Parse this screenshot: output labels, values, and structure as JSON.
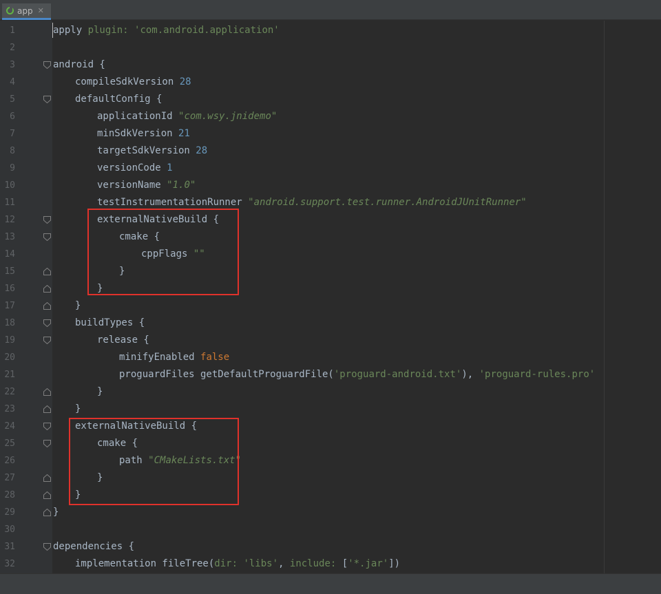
{
  "tab": {
    "label": "app",
    "close": "✕"
  },
  "code_lines": [
    {
      "n": "1",
      "indent": 0,
      "fold": null,
      "tokens": [
        [
          "apply ",
          "plain"
        ],
        [
          "plugin: ",
          "kw-arg"
        ],
        [
          "'com.android.application'",
          "str"
        ]
      ]
    },
    {
      "n": "2",
      "indent": 0,
      "fold": null,
      "tokens": []
    },
    {
      "n": "3",
      "indent": 0,
      "fold": "open",
      "tokens": [
        [
          "android {",
          "plain"
        ]
      ]
    },
    {
      "n": "4",
      "indent": 1,
      "fold": null,
      "tokens": [
        [
          "compileSdkVersion ",
          "plain"
        ],
        [
          "28",
          "num"
        ]
      ]
    },
    {
      "n": "5",
      "indent": 1,
      "fold": "open",
      "tokens": [
        [
          "defaultConfig {",
          "plain"
        ]
      ]
    },
    {
      "n": "6",
      "indent": 2,
      "fold": null,
      "tokens": [
        [
          "applicationId ",
          "plain"
        ],
        [
          "\"com.wsy.jnidemo\"",
          "str-i"
        ]
      ]
    },
    {
      "n": "7",
      "indent": 2,
      "fold": null,
      "tokens": [
        [
          "minSdkVersion ",
          "plain"
        ],
        [
          "21",
          "num"
        ]
      ]
    },
    {
      "n": "8",
      "indent": 2,
      "fold": null,
      "tokens": [
        [
          "targetSdkVersion ",
          "plain"
        ],
        [
          "28",
          "num"
        ]
      ]
    },
    {
      "n": "9",
      "indent": 2,
      "fold": null,
      "tokens": [
        [
          "versionCode ",
          "plain"
        ],
        [
          "1",
          "num"
        ]
      ]
    },
    {
      "n": "10",
      "indent": 2,
      "fold": null,
      "tokens": [
        [
          "versionName ",
          "plain"
        ],
        [
          "\"1.0\"",
          "str-i"
        ]
      ]
    },
    {
      "n": "11",
      "indent": 2,
      "fold": null,
      "tokens": [
        [
          "testInstrumentationRunner ",
          "plain"
        ],
        [
          "\"android.support.test.runner.AndroidJUnitRunner\"",
          "str-i"
        ]
      ]
    },
    {
      "n": "12",
      "indent": 2,
      "fold": "open",
      "tokens": [
        [
          "externalNativeBuild {",
          "plain"
        ]
      ]
    },
    {
      "n": "13",
      "indent": 3,
      "fold": "open",
      "tokens": [
        [
          "cmake {",
          "plain"
        ]
      ]
    },
    {
      "n": "14",
      "indent": 4,
      "fold": null,
      "tokens": [
        [
          "cppFlags ",
          "plain"
        ],
        [
          "\"\"",
          "str-i"
        ]
      ]
    },
    {
      "n": "15",
      "indent": 3,
      "fold": "close",
      "tokens": [
        [
          "}",
          "plain"
        ]
      ]
    },
    {
      "n": "16",
      "indent": 2,
      "fold": "close",
      "tokens": [
        [
          "}",
          "plain"
        ]
      ]
    },
    {
      "n": "17",
      "indent": 1,
      "fold": "close",
      "tokens": [
        [
          "}",
          "plain"
        ]
      ]
    },
    {
      "n": "18",
      "indent": 1,
      "fold": "open",
      "tokens": [
        [
          "buildTypes {",
          "plain"
        ]
      ]
    },
    {
      "n": "19",
      "indent": 2,
      "fold": "open",
      "tokens": [
        [
          "release {",
          "plain"
        ]
      ]
    },
    {
      "n": "20",
      "indent": 3,
      "fold": null,
      "tokens": [
        [
          "minifyEnabled ",
          "plain"
        ],
        [
          "false",
          "kw"
        ]
      ]
    },
    {
      "n": "21",
      "indent": 3,
      "fold": null,
      "tokens": [
        [
          "proguardFiles getDefaultProguardFile(",
          "plain"
        ],
        [
          "'proguard-android.txt'",
          "str"
        ],
        [
          "), ",
          "plain"
        ],
        [
          "'proguard-rules.pro'",
          "str"
        ]
      ]
    },
    {
      "n": "22",
      "indent": 2,
      "fold": "close",
      "tokens": [
        [
          "}",
          "plain"
        ]
      ]
    },
    {
      "n": "23",
      "indent": 1,
      "fold": "close",
      "tokens": [
        [
          "}",
          "plain"
        ]
      ]
    },
    {
      "n": "24",
      "indent": 1,
      "fold": "open",
      "tokens": [
        [
          "externalNativeBuild {",
          "plain"
        ]
      ]
    },
    {
      "n": "25",
      "indent": 2,
      "fold": "open",
      "tokens": [
        [
          "cmake {",
          "plain"
        ]
      ]
    },
    {
      "n": "26",
      "indent": 3,
      "fold": null,
      "tokens": [
        [
          "path ",
          "plain"
        ],
        [
          "\"CMakeLists.txt\"",
          "str-i"
        ]
      ]
    },
    {
      "n": "27",
      "indent": 2,
      "fold": "close",
      "tokens": [
        [
          "}",
          "plain"
        ]
      ]
    },
    {
      "n": "28",
      "indent": 1,
      "fold": "close",
      "tokens": [
        [
          "}",
          "plain"
        ]
      ]
    },
    {
      "n": "29",
      "indent": 0,
      "fold": "close",
      "tokens": [
        [
          "}",
          "plain"
        ]
      ]
    },
    {
      "n": "30",
      "indent": 0,
      "fold": null,
      "tokens": []
    },
    {
      "n": "31",
      "indent": 0,
      "fold": "open",
      "tokens": [
        [
          "dependencies {",
          "plain"
        ]
      ]
    },
    {
      "n": "32",
      "indent": 1,
      "fold": null,
      "tokens": [
        [
          "implementation fileTree(",
          "plain"
        ],
        [
          "dir: ",
          "kw-arg"
        ],
        [
          "'libs'",
          "str"
        ],
        [
          ", ",
          "plain"
        ],
        [
          "include: ",
          "kw-arg"
        ],
        [
          "[",
          "plain"
        ],
        [
          "'*.jar'",
          "str"
        ],
        [
          "])",
          "plain"
        ]
      ]
    }
  ],
  "highlight_color": "#e0322b"
}
